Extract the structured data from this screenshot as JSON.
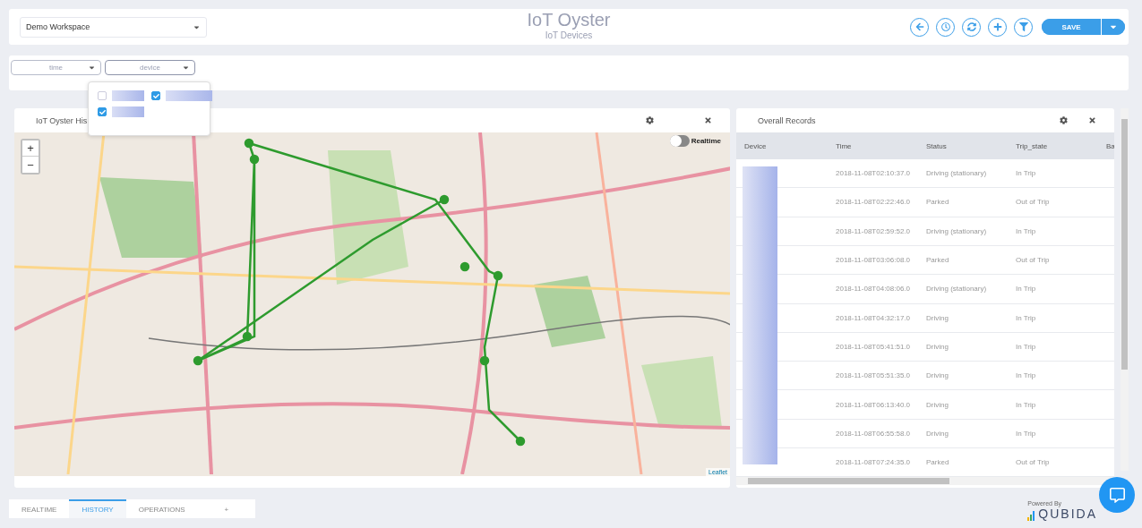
{
  "header": {
    "workspace": "Demo Workspace",
    "title": "IoT Oyster",
    "subtitle": "IoT Devices",
    "actions": [
      {
        "kind": "back"
      },
      {
        "kind": "clock"
      },
      {
        "kind": "refresh"
      },
      {
        "kind": "add"
      },
      {
        "kind": "filter"
      }
    ],
    "save": "SAVE"
  },
  "filters": [
    {
      "label": "time",
      "open": false
    },
    {
      "label": "device",
      "open": true
    }
  ],
  "device_options": [
    {
      "checked": false
    },
    {
      "checked": true
    },
    {
      "checked": true
    }
  ],
  "map_panel": {
    "title": "IoT Oyster His",
    "zoom_in": "+",
    "zoom_out": "−",
    "realtime": {
      "label": "Realtime",
      "on": false
    },
    "attribution": "Leaflet"
  },
  "records_panel": {
    "title": "Overall Records",
    "columns": [
      "Device",
      "Time",
      "Status",
      "Trip_state",
      "Ba"
    ],
    "rows": [
      {
        "time": "2018-11-08T02:10:37.0",
        "status": "Driving (stationary)",
        "trip_state": "In Trip"
      },
      {
        "time": "2018-11-08T02:22:46.0",
        "status": "Parked",
        "trip_state": "Out of Trip"
      },
      {
        "time": "2018-11-08T02:59:52.0",
        "status": "Driving (stationary)",
        "trip_state": "In Trip"
      },
      {
        "time": "2018-11-08T03:06:08.0",
        "status": "Parked",
        "trip_state": "Out of Trip"
      },
      {
        "time": "2018-11-08T04:08:06.0",
        "status": "Driving (stationary)",
        "trip_state": "In Trip"
      },
      {
        "time": "2018-11-08T04:32:17.0",
        "status": "Driving",
        "trip_state": "In Trip"
      },
      {
        "time": "2018-11-08T05:41:51.0",
        "status": "Driving",
        "trip_state": "In Trip"
      },
      {
        "time": "2018-11-08T05:51:35.0",
        "status": "Driving",
        "trip_state": "In Trip"
      },
      {
        "time": "2018-11-08T06:13:40.0",
        "status": "Driving",
        "trip_state": "In Trip"
      },
      {
        "time": "2018-11-08T06:55:58.0",
        "status": "Driving",
        "trip_state": "In Trip"
      },
      {
        "time": "2018-11-08T07:24:35.0",
        "status": "Parked",
        "trip_state": "Out of Trip"
      }
    ]
  },
  "tabs": [
    {
      "label": "REALTIME",
      "selected": false
    },
    {
      "label": "HISTORY",
      "selected": true
    },
    {
      "label": "OPERATIONS",
      "selected": false
    },
    {
      "label": "+",
      "selected": false
    }
  ],
  "footer": {
    "powered_by": "Powered By",
    "brand": "QUBIDA"
  }
}
